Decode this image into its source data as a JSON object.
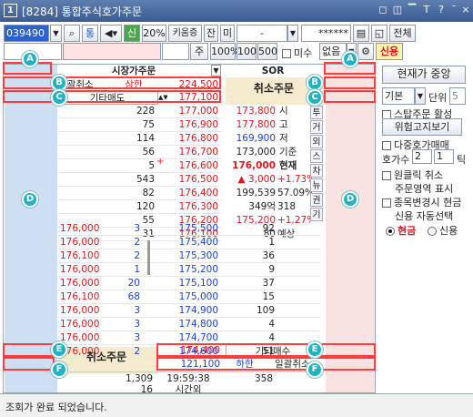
{
  "title": {
    "num": "1",
    "text": "[8284] 통합주식호가주문",
    "buttons": [
      "◻",
      "◫",
      "▔",
      "T",
      "?",
      "¯",
      "×"
    ]
  },
  "toolbar1": {
    "code": "039490",
    "btn1": "통",
    "btn2": "신",
    "pct": "20%",
    "order_type": "키움증",
    "jan": "잔",
    "mi": "미",
    "dash": "-",
    "pw": "******",
    "all_btn": "전체"
  },
  "toolbar2": {
    "ju": "주",
    "b100p": "100%",
    "b100": "100",
    "b500": "500",
    "misu": "미수",
    "none": "없음",
    "credit": "신용"
  },
  "header": {
    "market": "시장가주문",
    "sor": "SOR",
    "cancel_all": "일괄취소",
    "upper": "상한",
    "upper_price": "224,500",
    "cancel_order": "취소주문",
    "other_sell": "기타매도",
    "price_top": "177,100"
  },
  "sell_rows": [
    {
      "qty": "228",
      "price": "177,000"
    },
    {
      "qty": "75",
      "price": "176,900"
    },
    {
      "qty": "114",
      "price": "176,800"
    },
    {
      "qty": "56",
      "price": "176,700"
    },
    {
      "qty": "5",
      "price": "176,600"
    },
    {
      "qty": "543",
      "price": "176,500"
    },
    {
      "qty": "82",
      "price": "176,400"
    },
    {
      "qty": "120",
      "price": "176,300"
    },
    {
      "qty": "55",
      "price": "176,200"
    },
    {
      "qty": "31",
      "price": "176,100"
    }
  ],
  "info": [
    {
      "v": "173,800",
      "p": "",
      "l": "시",
      "cls": "red"
    },
    {
      "v": "177,800",
      "p": "",
      "l": "고",
      "cls": "red"
    },
    {
      "v": "169,900",
      "p": "",
      "l": "저",
      "cls": "blue"
    },
    {
      "v": "173,000",
      "p": "",
      "l": "기준",
      "cls": "blk"
    },
    {
      "v": "176,000",
      "p": "",
      "l": "현재",
      "cls": "red"
    },
    {
      "v": "▲ 3,000",
      "p": "+1.73%",
      "l": "",
      "cls": "red"
    },
    {
      "v": "199,539",
      "p": "57.09%",
      "l": "",
      "cls": "blk"
    },
    {
      "v": "349억",
      "p": "318",
      "l": "",
      "cls": "blk"
    },
    {
      "v": "175,200",
      "p": "+1.27%",
      "l": "",
      "cls": "red"
    },
    {
      "v": "80",
      "p": "예상",
      "l": "",
      "cls": "blk"
    }
  ],
  "side_tabs": [
    "투",
    "거",
    "외",
    "스",
    "차",
    "뉴",
    "권",
    "기"
  ],
  "buy_rows": [
    {
      "ord": "176,000",
      "oq": "3",
      "price": "175,500",
      "qty": "92"
    },
    {
      "ord": "176,000",
      "oq": "2",
      "price": "175,400",
      "qty": "1"
    },
    {
      "ord": "176,100",
      "oq": "2",
      "price": "175,300",
      "qty": "36"
    },
    {
      "ord": "176,000",
      "oq": "1",
      "price": "175,200",
      "qty": "9"
    },
    {
      "ord": "176,000",
      "oq": "20",
      "price": "175,100",
      "qty": "37"
    },
    {
      "ord": "176,100",
      "oq": "68",
      "price": "175,000",
      "qty": "15"
    },
    {
      "ord": "176,000",
      "oq": "3",
      "price": "174,900",
      "qty": "109"
    },
    {
      "ord": "176,000",
      "oq": "3",
      "price": "174,800",
      "qty": "4"
    },
    {
      "ord": "176,000",
      "oq": "3",
      "price": "174,700",
      "qty": "4"
    },
    {
      "ord": "176,000",
      "oq": "2",
      "price": "174,600",
      "qty": "51"
    }
  ],
  "footer": {
    "cancel_order": "취소주문",
    "price_bottom": "174,400",
    "other_buy": "기타매수",
    "lower_price": "121,100",
    "lower": "하한",
    "cancel_all": "일괄취소",
    "total_left": "1,309",
    "time": "19:59:38",
    "total_right": "358",
    "count": "16",
    "after": "시간외"
  },
  "right_panel": {
    "cur_price": "현재가 중앙",
    "basic": "기본",
    "unit_label": "단위",
    "unit": "5",
    "stop_order": "스탑주문 활성",
    "risk": "위험고지보기",
    "multi": "다중호가매매",
    "hoga_label": "호가수",
    "hoga1": "2",
    "hoga2": "1",
    "tick": "틱",
    "oneclick": "원클릭 취소",
    "order_area": "주문영역 표시",
    "change_cash": "종목변경시 현금",
    "credit_auto": "신용 자동선택",
    "cash": "현금",
    "credit": "신용"
  },
  "markers": [
    "A",
    "A",
    "B",
    "B",
    "C",
    "C",
    "D",
    "D",
    "E",
    "E",
    "F",
    "F"
  ],
  "status": "조회가 완료 되었습니다.",
  "colors": {
    "blue_col": "#cfdff3",
    "pink_col": "#f9e2e2",
    "cancel_bg": "#f5ebcf",
    "titlebar": "#3a5c93",
    "red_box": "#ff3b3b",
    "marker": "#1fb3c4"
  }
}
